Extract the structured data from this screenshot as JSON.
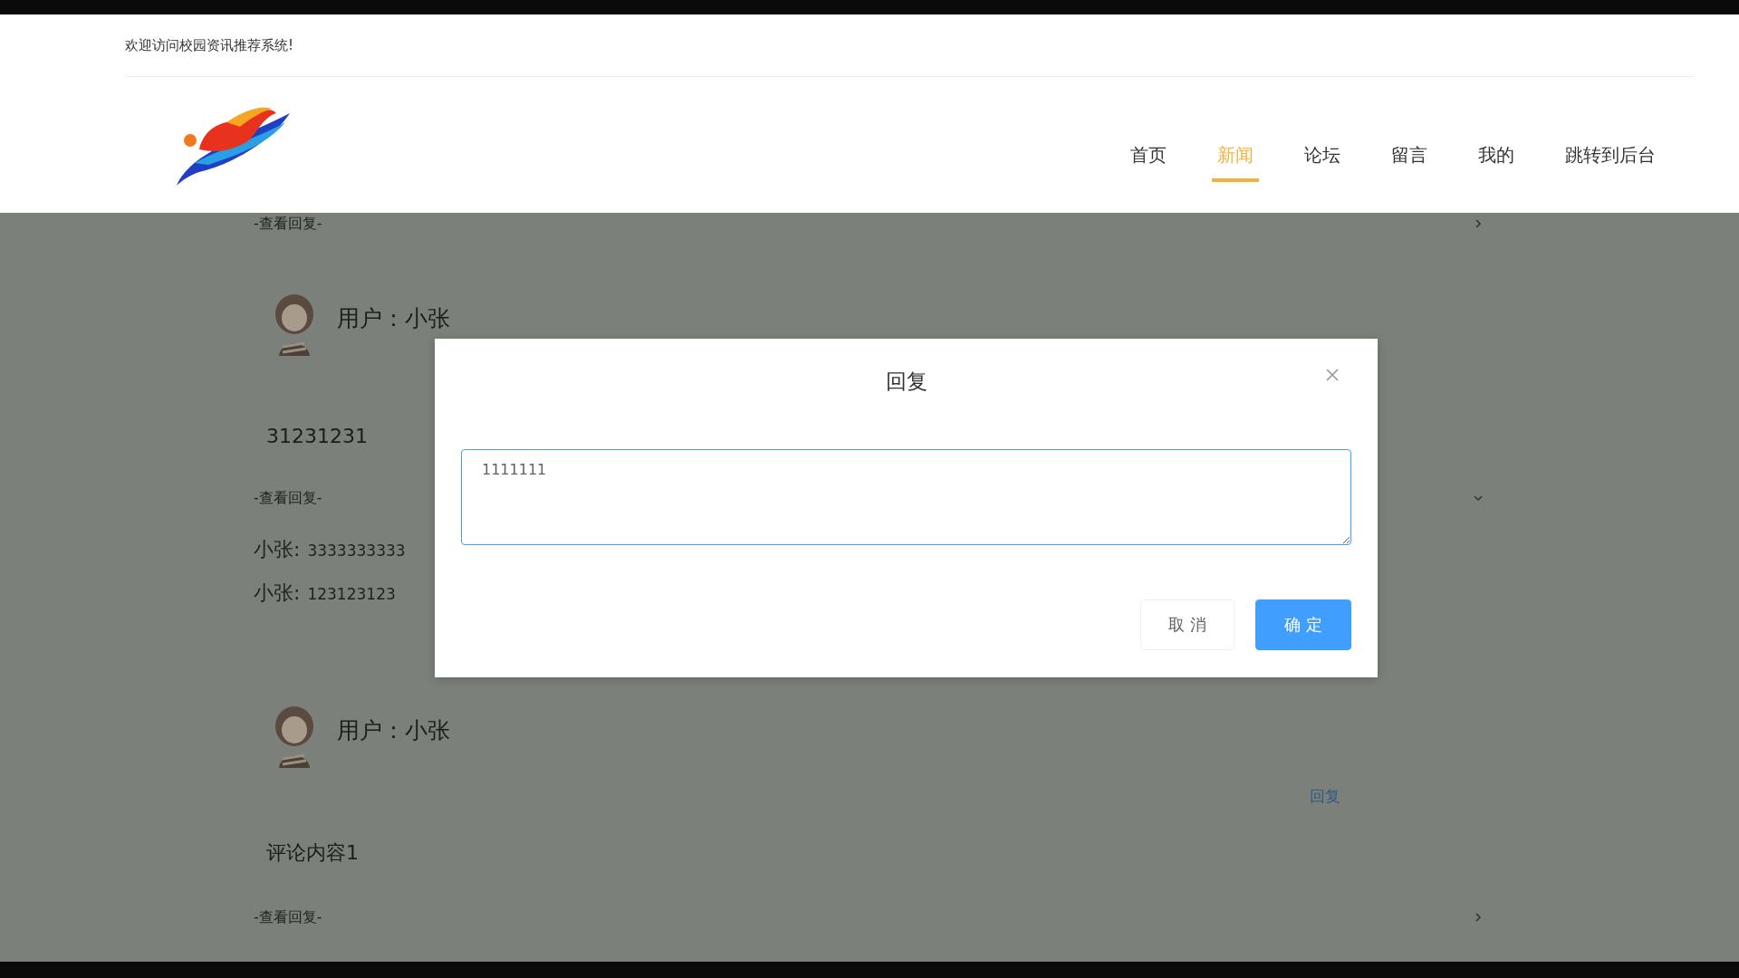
{
  "welcome": "欢迎访问校园资讯推荐系统!",
  "nav": [
    {
      "label": "首页",
      "selected": false
    },
    {
      "label": "新闻",
      "selected": true
    },
    {
      "label": "论坛",
      "selected": false
    },
    {
      "label": "留言",
      "selected": false
    },
    {
      "label": "我的",
      "selected": false
    },
    {
      "label": "跳转到后台",
      "selected": false
    }
  ],
  "thread": [
    {
      "kind": "toggle",
      "label": "-查看回复-",
      "expanded": false
    },
    {
      "kind": "user",
      "name": "用户：小张"
    },
    {
      "kind": "content",
      "text": "31231231"
    },
    {
      "kind": "toggle",
      "label": "-查看回复-",
      "expanded": true
    },
    {
      "kind": "reply",
      "user": "小张:",
      "text": "3333333333"
    },
    {
      "kind": "reply",
      "user": "小张:",
      "text": "123123123"
    },
    {
      "kind": "user",
      "name": "用户：小张"
    },
    {
      "kind": "action",
      "label": "回复"
    },
    {
      "kind": "content",
      "text": "评论内容1"
    },
    {
      "kind": "toggle",
      "label": "-查看回复-",
      "expanded": false
    }
  ],
  "dialog": {
    "title": "回复",
    "value": "1111111",
    "buttons": [
      {
        "label": "取 消",
        "kind": "plain"
      },
      {
        "label": "确 定",
        "kind": "primary"
      }
    ]
  }
}
